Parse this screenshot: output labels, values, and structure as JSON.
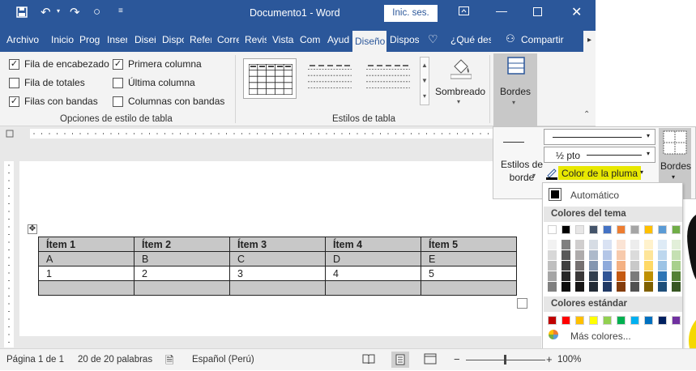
{
  "titlebar": {
    "save_icon": "save-icon",
    "undo_icon": "undo-icon",
    "redo_icon": "redo-icon",
    "circle_icon": "circle-icon",
    "customize_icon": "customize-qat-icon",
    "title": "Documento1  -  Word",
    "signin": "Inic. ses.",
    "window_buttons": [
      "ribbon-display-icon",
      "minimize-icon",
      "maximize-icon",
      "close-icon"
    ]
  },
  "tabs": [
    {
      "label": "Archivo"
    },
    {
      "label": "Inicio"
    },
    {
      "label": "Prog"
    },
    {
      "label": "Inser"
    },
    {
      "label": "Diseñ"
    },
    {
      "label": "Dispo"
    },
    {
      "label": "Refer"
    },
    {
      "label": "Corre"
    },
    {
      "label": "Revis"
    },
    {
      "label": "Vista"
    },
    {
      "label": "Com"
    },
    {
      "label": "Ayud"
    },
    {
      "label": "Diseño",
      "active": true
    },
    {
      "label": "Dispos"
    }
  ],
  "tell_me": "¿Qué des",
  "share": "Compartir",
  "table_style_options": {
    "label": "Opciones de estilo de tabla",
    "items": [
      {
        "label": "Fila de encabezado",
        "checked": true
      },
      {
        "label": "Fila de totales",
        "checked": false
      },
      {
        "label": "Filas con bandas",
        "checked": true
      },
      {
        "label": "Primera columna",
        "checked": true
      },
      {
        "label": "Última columna",
        "checked": false
      },
      {
        "label": "Columnas con bandas",
        "checked": false
      }
    ]
  },
  "table_styles": {
    "label": "Estilos de tabla",
    "shading": "Sombreado"
  },
  "borders": {
    "label": "Bordes"
  },
  "flyout": {
    "border_styles": "Estilos de\nborde",
    "line_weight": "½ pto",
    "pen_color": "Color de la pluma",
    "borders": "Bordes"
  },
  "color_menu": {
    "automatic": "Automático",
    "theme_header": "Colores del tema",
    "standard_header": "Colores estándar",
    "more_colors": "Más colores...",
    "theme_top": [
      "#ffffff",
      "#000000",
      "#e7e6e6",
      "#44546a",
      "#4472c4",
      "#ed7d31",
      "#a5a5a5",
      "#ffc000",
      "#5b9bd5",
      "#70ad47"
    ],
    "theme_shades": [
      [
        "#f2f2f2",
        "#7f7f7f",
        "#d0cece",
        "#d6dce4",
        "#d9e2f3",
        "#fbe4d5",
        "#ededed",
        "#fff2cc",
        "#deebf6",
        "#e2efd9"
      ],
      [
        "#d8d8d8",
        "#595959",
        "#aeabab",
        "#adb9ca",
        "#b4c6e7",
        "#f7caac",
        "#dbdbdb",
        "#fee599",
        "#bdd7ee",
        "#c5e0b3"
      ],
      [
        "#bfbfbf",
        "#3f3f3f",
        "#757070",
        "#8496b0",
        "#8eaadb",
        "#f4b183",
        "#c9c9c9",
        "#ffd965",
        "#9cc3e5",
        "#a8d08d"
      ],
      [
        "#a5a5a5",
        "#262626",
        "#3a3838",
        "#323f4f",
        "#2f5496",
        "#c55a11",
        "#7b7b7b",
        "#bf9000",
        "#2e75b5",
        "#538135"
      ],
      [
        "#7f7f7f",
        "#0c0c0c",
        "#171616",
        "#222a35",
        "#1f3864",
        "#833c0b",
        "#525252",
        "#7f6000",
        "#1e4e79",
        "#375623"
      ]
    ],
    "standard": [
      "#c00000",
      "#ff0000",
      "#ffc000",
      "#ffff00",
      "#92d050",
      "#00b050",
      "#00b0f0",
      "#0070c0",
      "#002060",
      "#7030a0"
    ]
  },
  "table": {
    "headers": [
      "Ítem 1",
      "Ítem 2",
      "Ítem 3",
      "Ítem 4",
      "Ítem 5"
    ],
    "rows": [
      [
        "A",
        "B",
        "C",
        "D",
        "E"
      ],
      [
        "1",
        "2",
        "3",
        "4",
        "5"
      ],
      [
        "",
        "",
        "",
        "",
        ""
      ]
    ]
  },
  "status": {
    "page": "Página 1 de 1",
    "words": "20 de 20 palabras",
    "language": "Español (Perú)",
    "zoom": "100%"
  },
  "colors": {
    "accent": "#2b579a",
    "pen_highlight": "#e8e800"
  }
}
